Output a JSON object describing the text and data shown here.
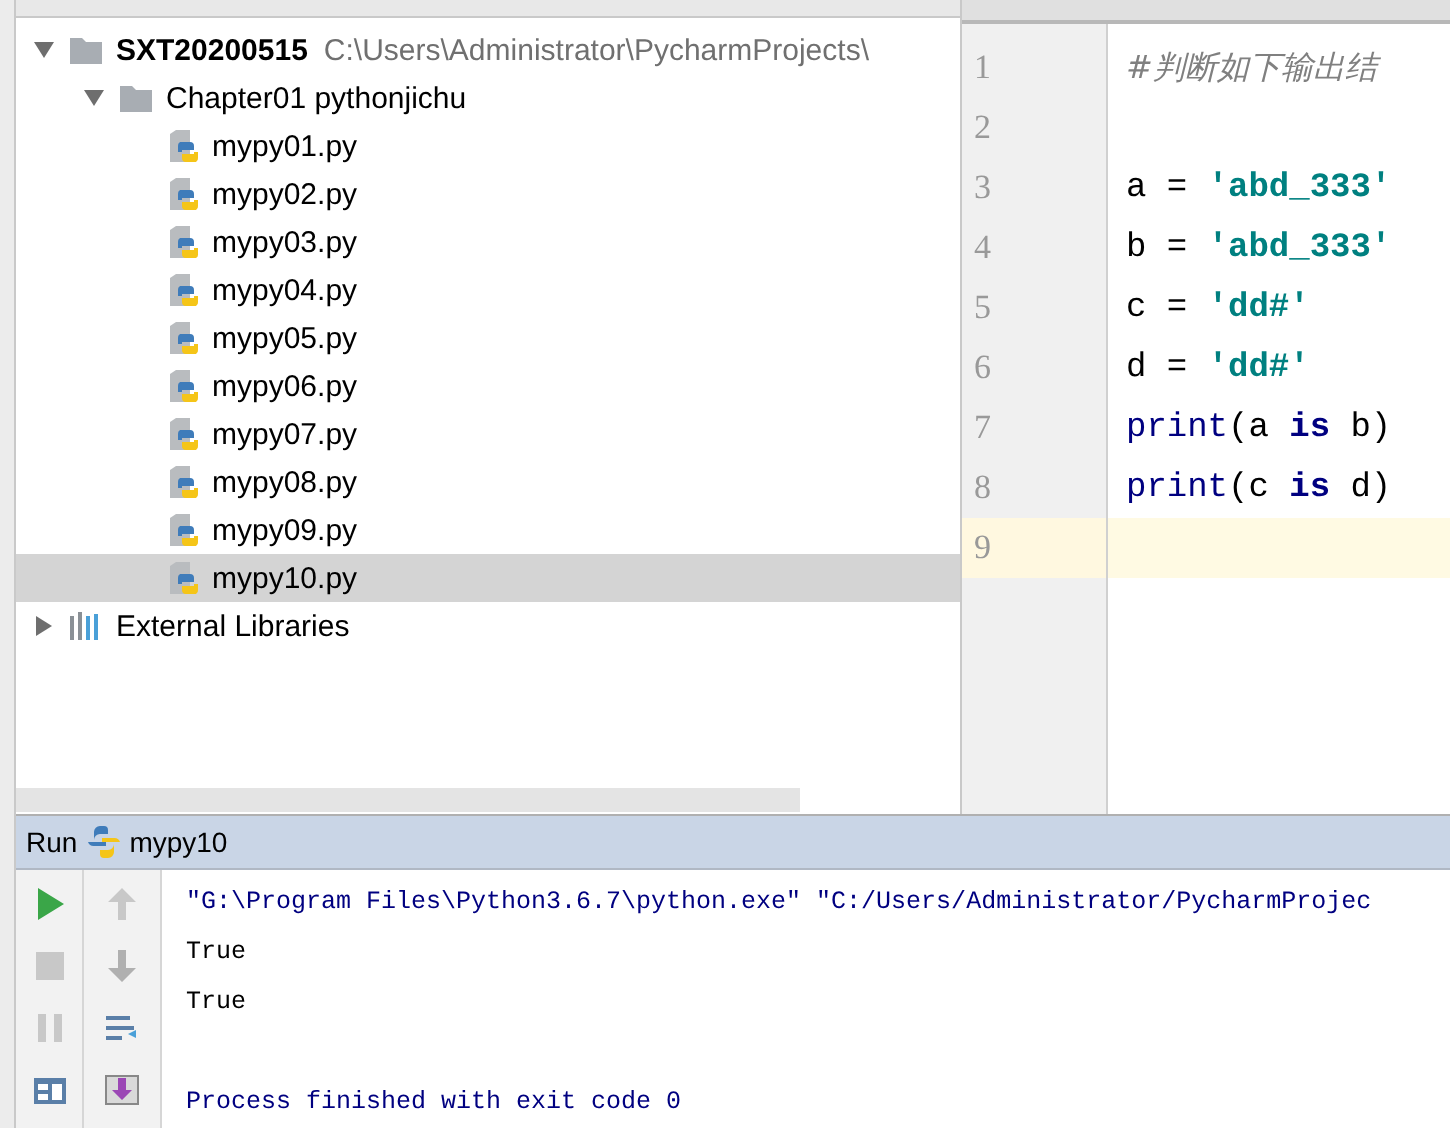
{
  "project_tree": {
    "items": [
      {
        "kind": "project",
        "label": "SXT20200515",
        "path": "C:\\Users\\Administrator\\PycharmProjects\\",
        "expanded": true,
        "selected": false,
        "children": [
          {
            "kind": "folder",
            "label": "Chapter01 pythonjichu",
            "expanded": true,
            "selected": false,
            "children": [
              {
                "kind": "file",
                "label": "mypy01.py",
                "selected": false
              },
              {
                "kind": "file",
                "label": "mypy02.py",
                "selected": false
              },
              {
                "kind": "file",
                "label": "mypy03.py",
                "selected": false
              },
              {
                "kind": "file",
                "label": "mypy04.py",
                "selected": false
              },
              {
                "kind": "file",
                "label": "mypy05.py",
                "selected": false
              },
              {
                "kind": "file",
                "label": "mypy06.py",
                "selected": false
              },
              {
                "kind": "file",
                "label": "mypy07.py",
                "selected": false
              },
              {
                "kind": "file",
                "label": "mypy08.py",
                "selected": false
              },
              {
                "kind": "file",
                "label": "mypy09.py",
                "selected": false
              },
              {
                "kind": "file",
                "label": "mypy10.py",
                "selected": true
              }
            ]
          }
        ]
      },
      {
        "kind": "libraries",
        "label": "External Libraries",
        "expanded": false,
        "selected": false
      }
    ]
  },
  "editor": {
    "lines": [
      {
        "number": "1",
        "current": false,
        "tokens": [
          {
            "kind": "comment",
            "text": "#判断如下输出结"
          }
        ]
      },
      {
        "number": "2",
        "current": false
      },
      {
        "number": "3",
        "current": false,
        "tokens": [
          {
            "kind": "plain",
            "text": "a = "
          },
          {
            "kind": "string",
            "text": "'abd_333'"
          }
        ]
      },
      {
        "number": "4",
        "current": false,
        "tokens": [
          {
            "kind": "plain",
            "text": "b = "
          },
          {
            "kind": "string",
            "text": "'abd_333'"
          }
        ]
      },
      {
        "number": "5",
        "current": false,
        "tokens": [
          {
            "kind": "plain",
            "text": "c = "
          },
          {
            "kind": "string",
            "text": "'dd#'"
          }
        ]
      },
      {
        "number": "6",
        "current": false,
        "tokens": [
          {
            "kind": "plain",
            "text": "d = "
          },
          {
            "kind": "string",
            "text": "'dd#'"
          }
        ]
      },
      {
        "number": "7",
        "current": false,
        "tokens": [
          {
            "kind": "builtin",
            "text": "print"
          },
          {
            "kind": "plain",
            "text": "(a "
          },
          {
            "kind": "keyword",
            "text": "is"
          },
          {
            "kind": "plain",
            "text": " b)"
          }
        ]
      },
      {
        "number": "8",
        "current": false,
        "tokens": [
          {
            "kind": "builtin",
            "text": "print"
          },
          {
            "kind": "plain",
            "text": "(c "
          },
          {
            "kind": "keyword",
            "text": "is"
          },
          {
            "kind": "plain",
            "text": " d)"
          }
        ]
      },
      {
        "number": "9",
        "current": true
      }
    ]
  },
  "run_panel": {
    "title": "Run",
    "config": "mypy10",
    "console": [
      {
        "kind": "command",
        "text": "\"G:\\Program Files\\Python3.6.7\\python.exe\" \"C:/Users/Administrator/PycharmProjec"
      },
      {
        "kind": "output",
        "text": "True"
      },
      {
        "kind": "output",
        "text": "True"
      },
      {
        "kind": "status",
        "text": "Process finished with exit code 0"
      }
    ]
  }
}
